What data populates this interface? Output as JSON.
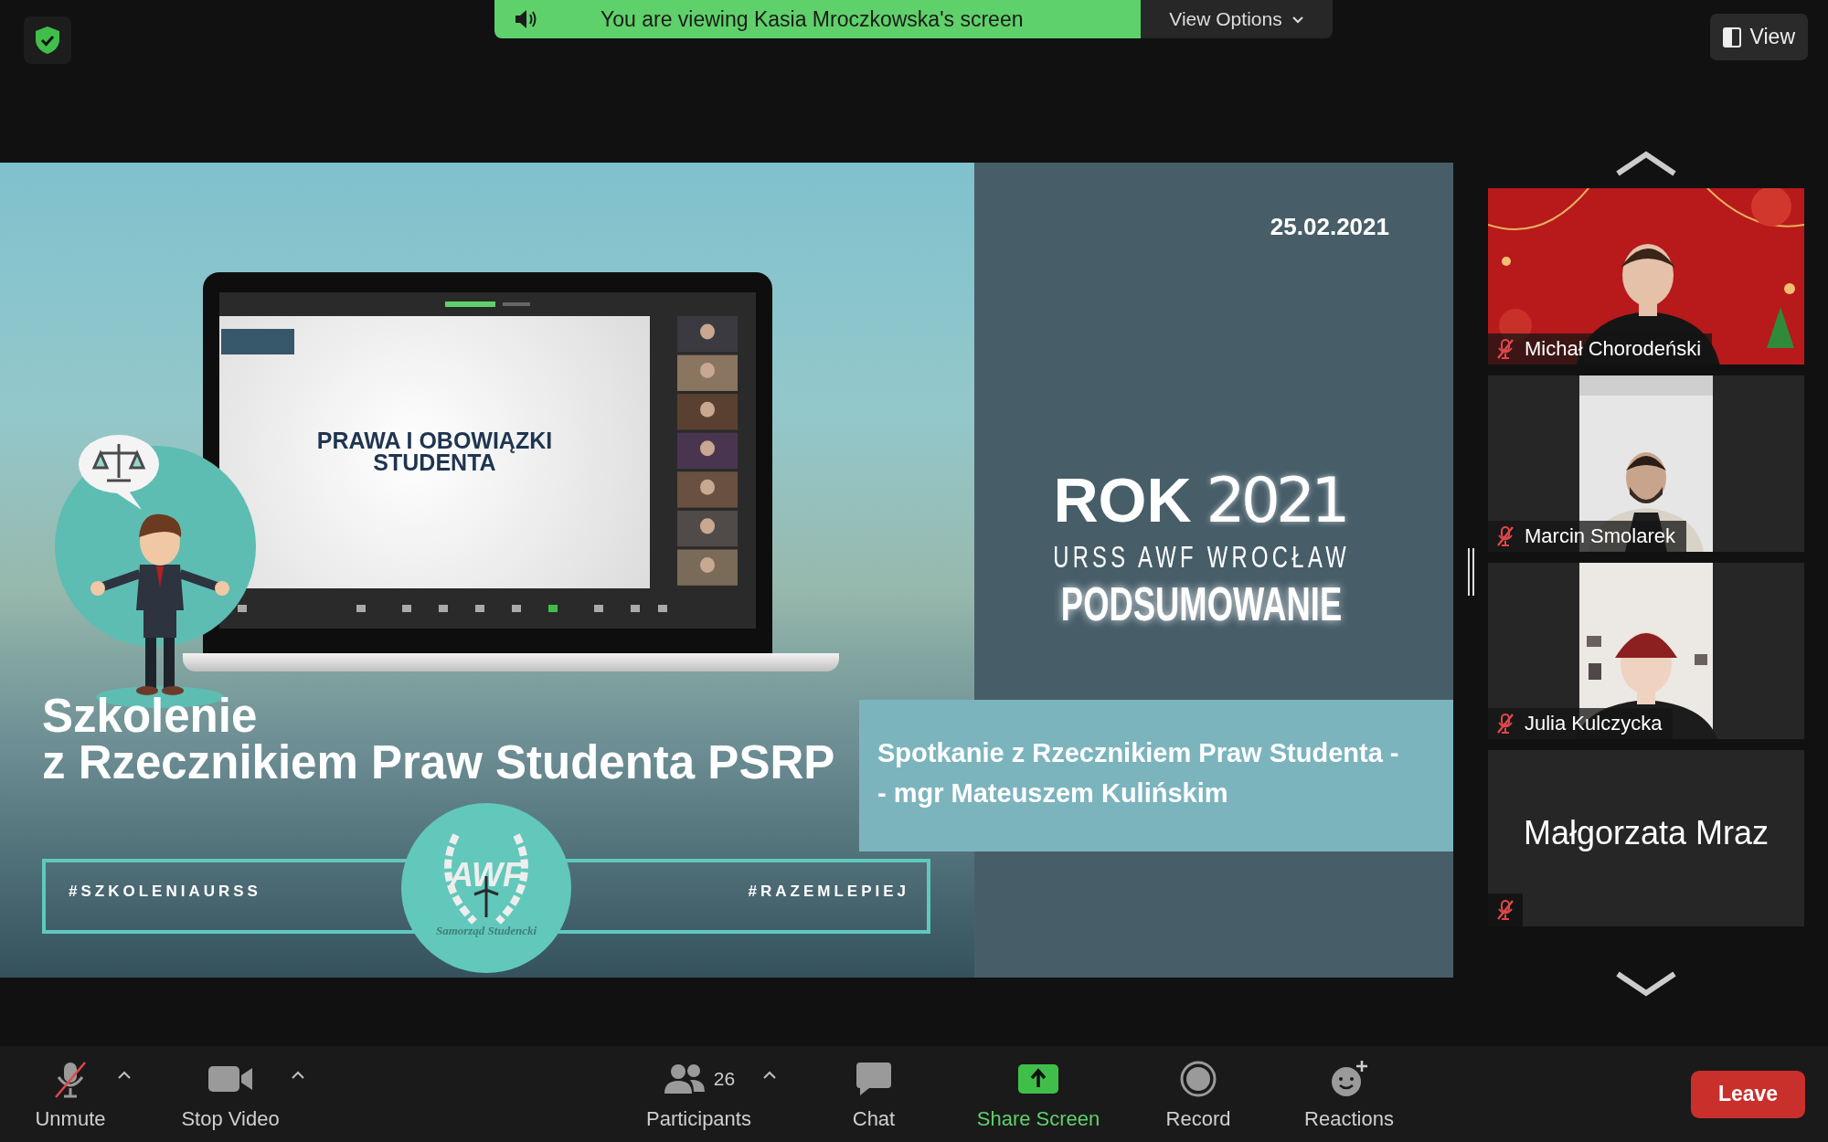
{
  "top_bar": {
    "banner": "You are viewing Kasia Mroczkowska's screen",
    "view_options": "View Options",
    "view_button": "View"
  },
  "slide": {
    "laptop_title_lines": [
      "PRAWA I OBOWIĄZKI",
      "STUDENTA"
    ],
    "heading_lines": [
      "Szkolenie",
      "z Rzecznikiem Praw Studenta PSRP"
    ],
    "hashtags": [
      "#SZKOLENIAURSS",
      "#RAZEMLEPIEJ"
    ],
    "logo_text": "AWF",
    "logo_caption": "Samorząd Studencki",
    "date": "25.02.2021",
    "year_label": "ROK",
    "year": "2021",
    "subtitle": "URSS AWF WROCŁAW",
    "summary": "PODSUMOWANIE",
    "meeting_lines": [
      "Spotkanie z Rzecznikiem Praw Studenta -",
      "- mgr Mateuszem Kulińskim"
    ]
  },
  "gallery": {
    "participants": [
      {
        "name": "Michał Chorodeński",
        "muted": true,
        "kind": "festive"
      },
      {
        "name": "Marcin Smolarek",
        "muted": true,
        "kind": "portrait"
      },
      {
        "name": "Julia Kulczycka",
        "muted": true,
        "kind": "cap"
      },
      {
        "name": "Małgorzata Mraz",
        "muted": true,
        "kind": "name_only"
      }
    ]
  },
  "toolbar": {
    "items": [
      {
        "kind": "unmute",
        "label": "Unmute",
        "caret": true
      },
      {
        "kind": "video",
        "label": "Stop Video",
        "caret": true
      },
      {
        "kind": "participants",
        "label": "Participants",
        "count": "26",
        "caret": true
      },
      {
        "kind": "chat",
        "label": "Chat",
        "caret": false
      },
      {
        "kind": "share",
        "label": "Share Screen",
        "caret": false
      },
      {
        "kind": "record",
        "label": "Record",
        "caret": false
      },
      {
        "kind": "reactions",
        "label": "Reactions",
        "caret": false
      }
    ],
    "leave": "Leave"
  }
}
